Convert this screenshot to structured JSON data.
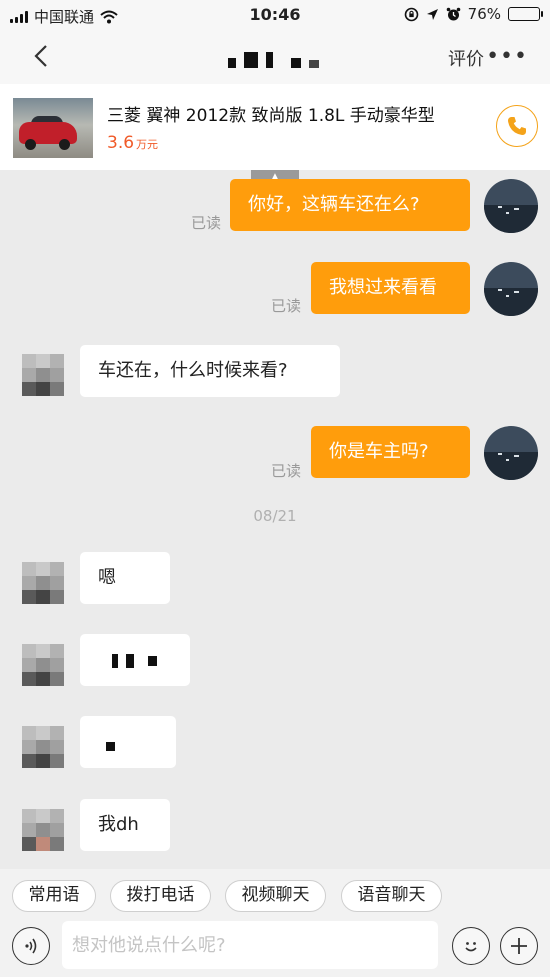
{
  "status_bar": {
    "carrier": "中国联通",
    "time": "10:46",
    "battery": "76%",
    "battery_level": 0.76
  },
  "nav": {
    "rate_label": "评价",
    "more_label": "•••"
  },
  "car": {
    "name": "三菱 翼神 2012款 致尚版 1.8L 手动豪华型",
    "price": "3.6",
    "price_unit": "万元"
  },
  "messages": {
    "m1": {
      "text": "你好，这辆车还在么?",
      "read": "已读"
    },
    "m2": {
      "text": "我想过来看看",
      "read": "已读"
    },
    "m3": {
      "text": "车还在，什么时候来看?"
    },
    "m4": {
      "text": "你是车主吗?",
      "read": "已读"
    },
    "date": "08/21",
    "m5": {
      "text": "嗯"
    },
    "m8": {
      "text": "我dh"
    }
  },
  "quick_replies": [
    "常用语",
    "拨打电话",
    "视频聊天",
    "语音聊天"
  ],
  "input": {
    "placeholder": "想对他说点什么呢?"
  },
  "colors": {
    "accent": "#ff9d0c",
    "price": "#f05a28",
    "phone": "#f4a31a"
  }
}
